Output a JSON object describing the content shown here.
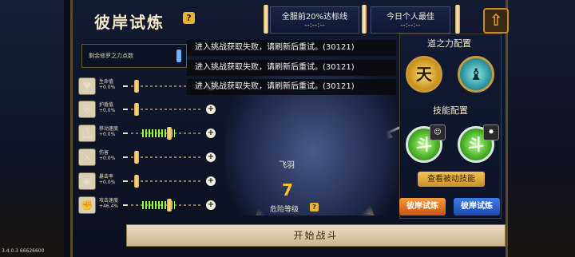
{
  "title": "彼岸试炼",
  "help_label": "?",
  "header": {
    "server_label": "全服前20%达标线",
    "server_value": "--:--:--",
    "personal_label": "今日个人最佳",
    "personal_value": "--:--:--"
  },
  "up_label": "⇧",
  "points_label": "剩余修罗之力点数",
  "attributes": [
    {
      "name": "生命值",
      "value": "+0.0%",
      "icon": "heart-icon",
      "glyph": "♥",
      "fill": 0
    },
    {
      "name": "护盾值",
      "value": "+0.0%",
      "icon": "shield-icon",
      "glyph": "⛨",
      "fill": 0
    },
    {
      "name": "移动速度",
      "value": "+0.0%",
      "icon": "boot-icon",
      "glyph": "⛸",
      "fill": 0.45
    },
    {
      "name": "伤害",
      "value": "+0.0%",
      "icon": "sword-icon",
      "glyph": "⚔",
      "fill": 0
    },
    {
      "name": "暴击率",
      "value": "+0.0%",
      "icon": "eye-icon",
      "glyph": "◉",
      "fill": 0
    },
    {
      "name": "攻击速度",
      "value": "+46.4%",
      "icon": "fist-icon",
      "glyph": "✊",
      "fill": 0.45
    }
  ],
  "toasts": [
    "进入挑战获取失败，请刷新后重试。(30121)",
    "进入挑战获取失败，请刷新后重试。(30121)",
    "进入挑战获取失败，请刷新后重试。(30121)"
  ],
  "hero": {
    "name": "飞羽",
    "level": "7"
  },
  "danger_label": "危险等级",
  "right": {
    "dao_title": "道之力配置",
    "skill_title": "技能配置",
    "dao_icons": [
      {
        "icon": "dao-power-icon-1",
        "glyph": "天"
      },
      {
        "icon": "dao-power-icon-2",
        "glyph": "♝"
      }
    ],
    "skill_glyph": "斗",
    "passive_label": "查看被动技能"
  },
  "trial_left_label": "彼岸试炼",
  "trial_right_label": "彼岸试炼",
  "start_label": "开始战斗",
  "version": "3.4.0.3 66626600",
  "colors": {
    "accent": "#f3c455",
    "fill_green": "#8dff40",
    "toast_bg": "#0a0a0e"
  }
}
